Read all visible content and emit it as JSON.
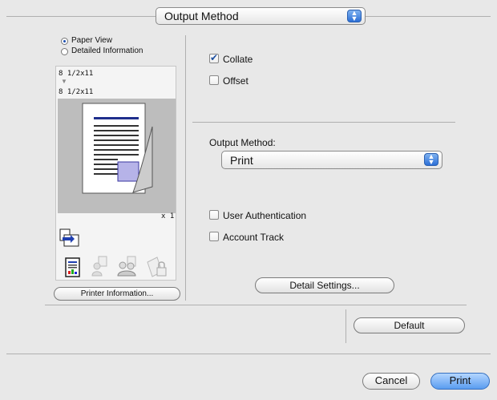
{
  "header": {
    "output_method_popup": "Output Method"
  },
  "left_panel": {
    "radio_paper_view": "Paper View",
    "radio_detailed_information": "Detailed Information",
    "paper_from": "8 1/2x11",
    "paper_to": "8 1/2x11",
    "copies_label": "x 1",
    "printer_information_button": "Printer Information..."
  },
  "right_panel": {
    "collate_label": "Collate",
    "collate_checked": true,
    "offset_label": "Offset",
    "offset_checked": false,
    "output_method_label": "Output Method:",
    "output_method_value": "Print",
    "user_authentication_label": "User Authentication",
    "account_track_label": "Account Track",
    "detail_settings_button": "Detail Settings..."
  },
  "footer": {
    "default_button": "Default",
    "cancel_button": "Cancel",
    "print_button": "Print"
  },
  "colors": {
    "accent_blue": "#2c6fd6",
    "preview_gray": "#bdbdbd"
  }
}
